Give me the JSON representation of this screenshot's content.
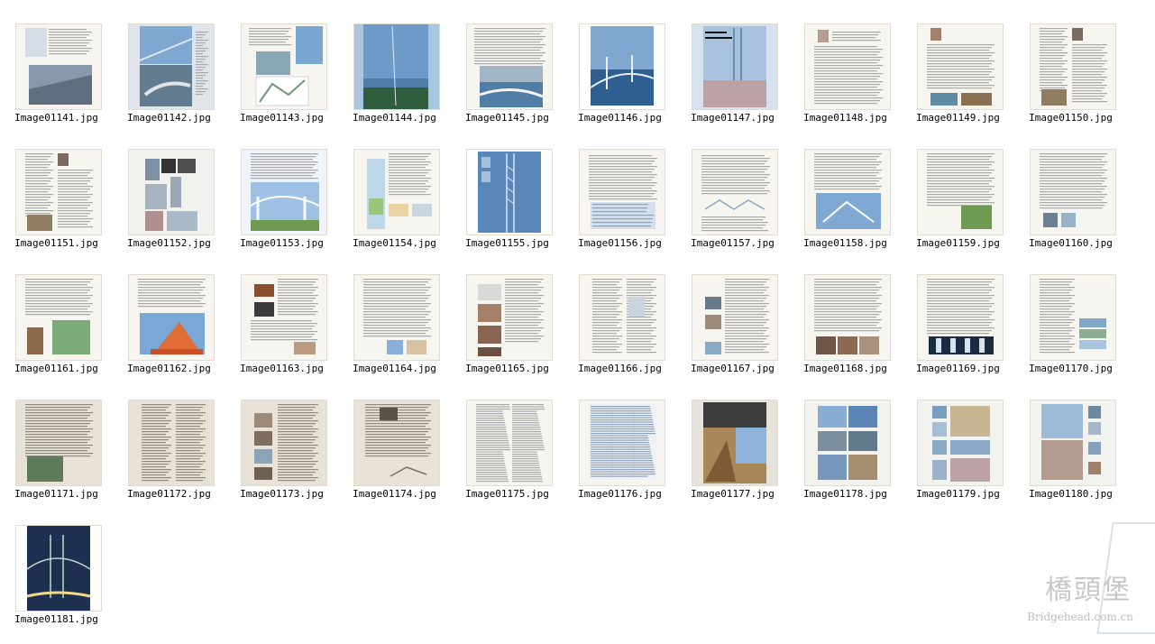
{
  "view": {
    "items": [
      {
        "filename": "Image01141.jpg",
        "thumb": "page-bridge-top"
      },
      {
        "filename": "Image01142.jpg",
        "thumb": "aerial-photo"
      },
      {
        "filename": "Image01143.jpg",
        "thumb": "page-photos-map"
      },
      {
        "filename": "Image01144.jpg",
        "thumb": "full-photo-sea"
      },
      {
        "filename": "Image01145.jpg",
        "thumb": "page-bridge-bottom"
      },
      {
        "filename": "Image01146.jpg",
        "thumb": "full-photo-bridge"
      },
      {
        "filename": "Image01147.jpg",
        "thumb": "crowd-bridge"
      },
      {
        "filename": "Image01148.jpg",
        "thumb": "text-portrait"
      },
      {
        "filename": "Image01149.jpg",
        "thumb": "text-portrait-photos"
      },
      {
        "filename": "Image01150.jpg",
        "thumb": "text-portrait-photo"
      },
      {
        "filename": "Image01151.jpg",
        "thumb": "text-portrait-photo"
      },
      {
        "filename": "Image01152.jpg",
        "thumb": "photo-collage"
      },
      {
        "filename": "Image01153.jpg",
        "thumb": "illustration-bridge"
      },
      {
        "filename": "Image01154.jpg",
        "thumb": "page-map-diagrams"
      },
      {
        "filename": "Image01155.jpg",
        "thumb": "blue-cover"
      },
      {
        "filename": "Image01156.jpg",
        "thumb": "text-tables"
      },
      {
        "filename": "Image01157.jpg",
        "thumb": "text-diagram"
      },
      {
        "filename": "Image01158.jpg",
        "thumb": "text-diagrams-blue"
      },
      {
        "filename": "Image01159.jpg",
        "thumb": "text-photo-green"
      },
      {
        "filename": "Image01160.jpg",
        "thumb": "text-photos-small"
      },
      {
        "filename": "Image01161.jpg",
        "thumb": "text-photos-green"
      },
      {
        "filename": "Image01162.jpg",
        "thumb": "crane-ship"
      },
      {
        "filename": "Image01163.jpg",
        "thumb": "text-photos-dark"
      },
      {
        "filename": "Image01164.jpg",
        "thumb": "text-photos-blue"
      },
      {
        "filename": "Image01165.jpg",
        "thumb": "text-diagrams-brown"
      },
      {
        "filename": "Image01166.jpg",
        "thumb": "text-diagrams-small"
      },
      {
        "filename": "Image01167.jpg",
        "thumb": "text-photos-left"
      },
      {
        "filename": "Image01168.jpg",
        "thumb": "text-photos-bottom"
      },
      {
        "filename": "Image01169.jpg",
        "thumb": "text-photo-strip"
      },
      {
        "filename": "Image01170.jpg",
        "thumb": "text-photo-stack"
      },
      {
        "filename": "Image01171.jpg",
        "thumb": "old-paper-photo"
      },
      {
        "filename": "Image01172.jpg",
        "thumb": "old-paper-text"
      },
      {
        "filename": "Image01173.jpg",
        "thumb": "old-paper-photos"
      },
      {
        "filename": "Image01174.jpg",
        "thumb": "old-paper-diagram"
      },
      {
        "filename": "Image01175.jpg",
        "thumb": "dense-text"
      },
      {
        "filename": "Image01176.jpg",
        "thumb": "dense-table"
      },
      {
        "filename": "Image01177.jpg",
        "thumb": "festival-photo"
      },
      {
        "filename": "Image01178.jpg",
        "thumb": "photo-grid-sea"
      },
      {
        "filename": "Image01179.jpg",
        "thumb": "photo-grid-beach"
      },
      {
        "filename": "Image01180.jpg",
        "thumb": "photo-grid-crowd"
      },
      {
        "filename": "Image01181.jpg",
        "thumb": "night-bridge"
      }
    ]
  },
  "watermark": {
    "logo_text": "橋頭堡",
    "site_text": "Bridgehead.com.cn"
  },
  "colors": {
    "frame_border": "#e0dccf",
    "paper": "#f6f5ef",
    "old_paper": "#e8e3d6",
    "text_line": "#a9a9a9",
    "sky_blue": "#7fa7cf",
    "sea_blue": "#4f7da6",
    "night": "#1f2f52",
    "green": "#6f9a52",
    "brown": "#8d6b4a",
    "crowd": "#bca2a6"
  }
}
